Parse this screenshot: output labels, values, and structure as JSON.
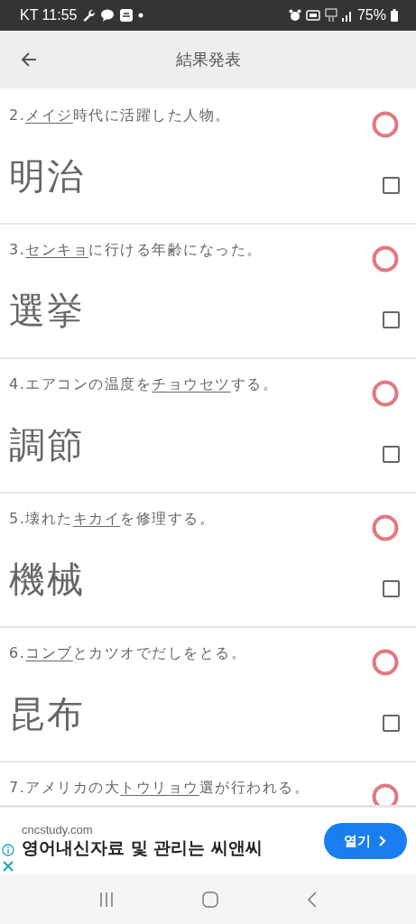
{
  "status_bar": {
    "carrier_time": "KT 11:55",
    "battery": "75%"
  },
  "app_bar": {
    "title": "結果発表"
  },
  "questions": [
    {
      "number": "2.",
      "target": "メイジ",
      "after": "時代に活躍した人物。",
      "answer": "明治",
      "correct": true,
      "checked": false
    },
    {
      "number": "3.",
      "target": "センキョ",
      "after": "に行ける年齢になった。",
      "answer": "選挙",
      "correct": true,
      "checked": false
    },
    {
      "number": "4.",
      "before": "エアコンの温度を",
      "target": "チョウセツ",
      "after": "する。",
      "answer": "調節",
      "correct": true,
      "checked": false
    },
    {
      "number": "5.",
      "before": "壊れた",
      "target": "キカイ",
      "after": "を修理する。",
      "answer": "機械",
      "correct": true,
      "checked": false
    },
    {
      "number": "6.",
      "target": "コンブ",
      "after": "とカツオでだしをとる。",
      "answer": "昆布",
      "correct": true,
      "checked": false
    },
    {
      "number": "7.",
      "before": "アメリカの大",
      "target": "トウリョウ",
      "after": "選が行われる。",
      "correct": true
    }
  ],
  "ad": {
    "domain": "cncstudy.com",
    "headline": "영어내신자료 및 관리는 씨앤씨",
    "button": "열기"
  }
}
